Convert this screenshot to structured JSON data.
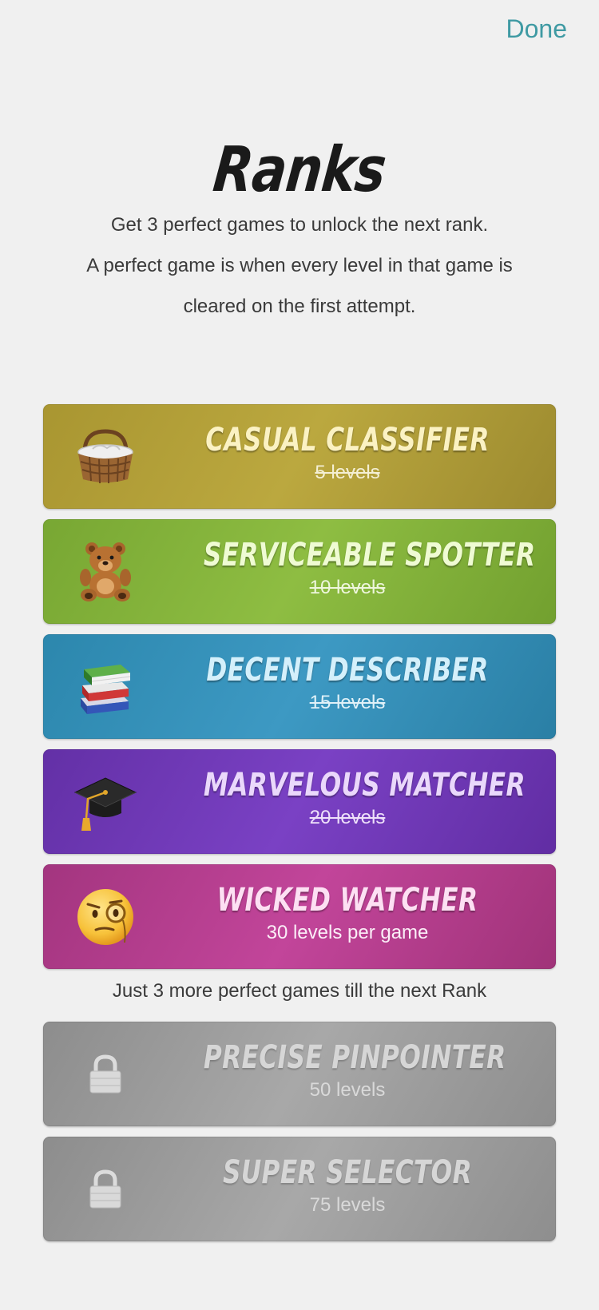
{
  "header": {
    "done_label": "Done"
  },
  "title": "Ranks",
  "intro": {
    "line1": "Get 3 perfect games to unlock the next rank.",
    "line2": "A perfect game is when every level in that game is",
    "line3": "cleared on the first attempt."
  },
  "ranks": [
    {
      "name": "Casual Classifier",
      "levels": "5 levels",
      "icon": "basket-icon",
      "status": "completed"
    },
    {
      "name": "Serviceable Spotter",
      "levels": "10 levels",
      "icon": "teddy-bear-icon",
      "status": "completed"
    },
    {
      "name": "Decent Describer",
      "levels": "15 levels",
      "icon": "books-icon",
      "status": "completed"
    },
    {
      "name": "Marvelous Matcher",
      "levels": "20 levels",
      "icon": "graduation-cap-icon",
      "status": "completed"
    },
    {
      "name": "Wicked Watcher",
      "levels": "30 levels per game",
      "icon": "monocle-face-icon",
      "status": "current"
    },
    {
      "name": "Precise Pinpointer",
      "levels": "50 levels",
      "icon": "lock-icon",
      "status": "locked"
    },
    {
      "name": "Super Selector",
      "levels": "75 levels",
      "icon": "lock-icon",
      "status": "locked"
    }
  ],
  "next_rank_message": "Just 3 more perfect games till the next Rank",
  "colors": {
    "background": "#f0f0f0",
    "done": "#3f9aa3",
    "casual": "#bba83f",
    "serviceable": "#8ebd42",
    "decent": "#3d99c3",
    "marvelous": "#7a41c4",
    "wicked": "#c2459a",
    "locked": "#a8a8a8"
  }
}
